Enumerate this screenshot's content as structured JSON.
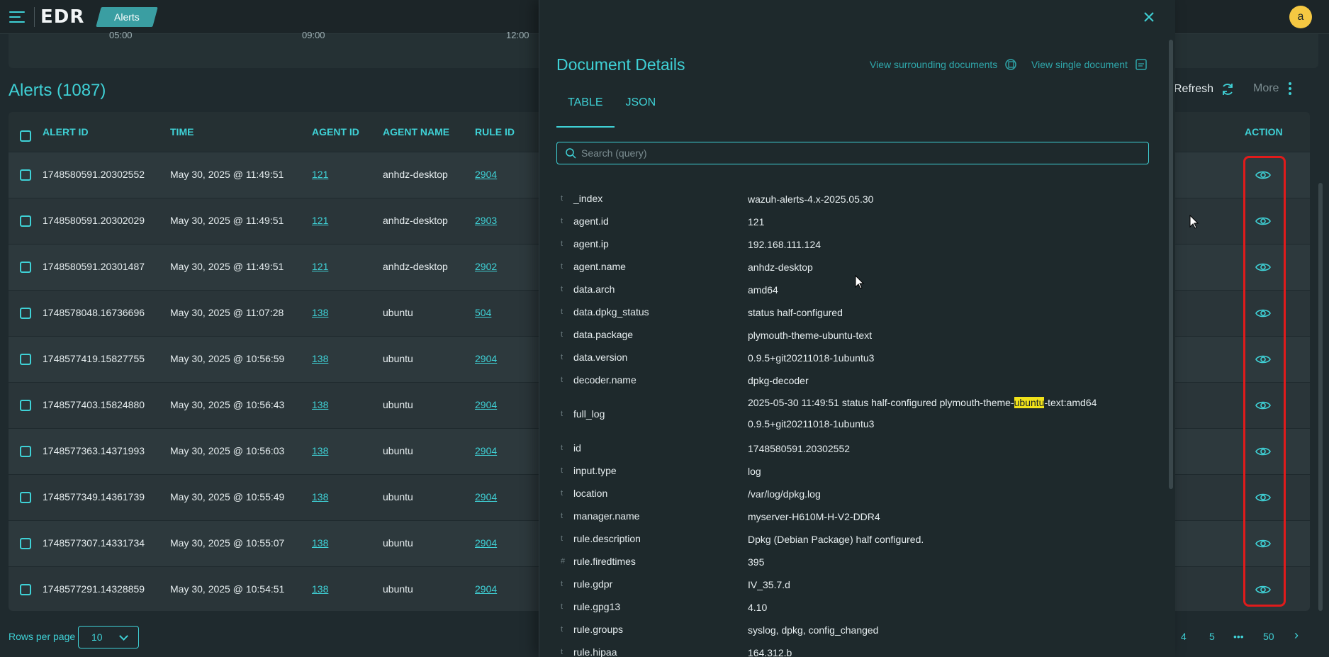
{
  "header": {
    "logo": "EDR",
    "breadcrumb": "Alerts",
    "avatar_initial": "a"
  },
  "chart_ticks": [
    "05:00",
    "09:00",
    "12:00"
  ],
  "alerts": {
    "title": "Alerts (1087)",
    "refresh_label": "Refresh",
    "more_label": "More"
  },
  "table": {
    "columns": [
      "ALERT ID",
      "TIME",
      "AGENT ID",
      "AGENT NAME",
      "RULE ID",
      "ACTION"
    ],
    "rows": [
      {
        "alert_id": "1748580591.20302552",
        "time": "May 30, 2025 @ 11:49:51",
        "agent_id": "121",
        "agent_name": "anhdz-desktop",
        "rule_id": "2904"
      },
      {
        "alert_id": "1748580591.20302029",
        "time": "May 30, 2025 @ 11:49:51",
        "agent_id": "121",
        "agent_name": "anhdz-desktop",
        "rule_id": "2903"
      },
      {
        "alert_id": "1748580591.20301487",
        "time": "May 30, 2025 @ 11:49:51",
        "agent_id": "121",
        "agent_name": "anhdz-desktop",
        "rule_id": "2902"
      },
      {
        "alert_id": "1748578048.16736696",
        "time": "May 30, 2025 @ 11:07:28",
        "agent_id": "138",
        "agent_name": "ubuntu",
        "rule_id": "504"
      },
      {
        "alert_id": "1748577419.15827755",
        "time": "May 30, 2025 @ 10:56:59",
        "agent_id": "138",
        "agent_name": "ubuntu",
        "rule_id": "2904"
      },
      {
        "alert_id": "1748577403.15824880",
        "time": "May 30, 2025 @ 10:56:43",
        "agent_id": "138",
        "agent_name": "ubuntu",
        "rule_id": "2904"
      },
      {
        "alert_id": "1748577363.14371993",
        "time": "May 30, 2025 @ 10:56:03",
        "agent_id": "138",
        "agent_name": "ubuntu",
        "rule_id": "2904"
      },
      {
        "alert_id": "1748577349.14361739",
        "time": "May 30, 2025 @ 10:55:49",
        "agent_id": "138",
        "agent_name": "ubuntu",
        "rule_id": "2904"
      },
      {
        "alert_id": "1748577307.14331734",
        "time": "May 30, 2025 @ 10:55:07",
        "agent_id": "138",
        "agent_name": "ubuntu",
        "rule_id": "2904"
      },
      {
        "alert_id": "1748577291.14328859",
        "time": "May 30, 2025 @ 10:54:51",
        "agent_id": "138",
        "agent_name": "ubuntu",
        "rule_id": "2904"
      }
    ]
  },
  "pagination": {
    "rows_per_page_label": "Rows per page",
    "rows_per_page_value": "10",
    "pages": [
      "4",
      "5",
      "•••",
      "50",
      "›"
    ]
  },
  "flyout": {
    "title": "Document Details",
    "view_surrounding": "View surrounding documents",
    "view_single": "View single document",
    "tabs": [
      "TABLE",
      "JSON"
    ],
    "active_tab": "TABLE",
    "search_placeholder": "Search (query)",
    "fields": [
      {
        "type": "t",
        "key": "_index",
        "value": "wazuh-alerts-4.x-2025.05.30"
      },
      {
        "type": "t",
        "key": "agent.id",
        "value": "121"
      },
      {
        "type": "t",
        "key": "agent.ip",
        "value": "192.168.111.124"
      },
      {
        "type": "t",
        "key": "agent.name",
        "value": "anhdz-desktop"
      },
      {
        "type": "t",
        "key": "data.arch",
        "value": "amd64"
      },
      {
        "type": "t",
        "key": "data.dpkg_status",
        "value": "status half-configured"
      },
      {
        "type": "t",
        "key": "data.package",
        "value": "plymouth-theme-ubuntu-text"
      },
      {
        "type": "t",
        "key": "data.version",
        "value": "0.9.5+git20211018-1ubuntu3"
      },
      {
        "type": "t",
        "key": "decoder.name",
        "value": "dpkg-decoder"
      },
      {
        "type": "t",
        "key": "full_log",
        "value_pre": "2025-05-30 11:49:51 status half-configured plymouth-theme-",
        "value_hl": "ubuntu",
        "value_post": "-text:amd64 0.9.5+git20211018-1ubuntu3"
      },
      {
        "type": "t",
        "key": "id",
        "value": "1748580591.20302552"
      },
      {
        "type": "t",
        "key": "input.type",
        "value": "log"
      },
      {
        "type": "t",
        "key": "location",
        "value": "/var/log/dpkg.log"
      },
      {
        "type": "t",
        "key": "manager.name",
        "value": "myserver-H610M-H-V2-DDR4"
      },
      {
        "type": "t",
        "key": "rule.description",
        "value": "Dpkg (Debian Package) half configured."
      },
      {
        "type": "#",
        "key": "rule.firedtimes",
        "value": "395"
      },
      {
        "type": "t",
        "key": "rule.gdpr",
        "value": "IV_35.7.d"
      },
      {
        "type": "t",
        "key": "rule.gpg13",
        "value": "4.10"
      },
      {
        "type": "t",
        "key": "rule.groups",
        "value": "syslog, dpkg, config_changed"
      },
      {
        "type": "t",
        "key": "rule.hipaa",
        "value": "164.312.b"
      }
    ]
  },
  "colors": {
    "accent": "#3fd1d6",
    "highlight_box": "#e01b1b",
    "search_highlight": "#f1e21a"
  }
}
